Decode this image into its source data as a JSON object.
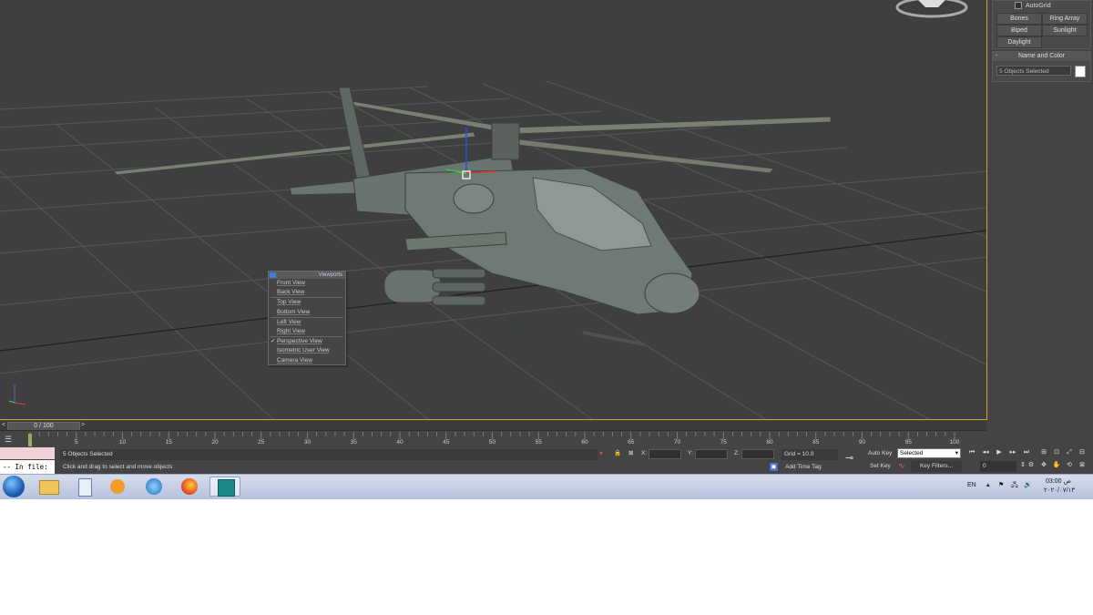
{
  "command_panel": {
    "autogrid_label": "AutoGrid",
    "buttons": [
      "Bones",
      "Ring Array",
      "Biped",
      "Sunlight",
      "Daylight"
    ],
    "name_color_title": "Name and Color",
    "name_value": "5 Objects Selected",
    "name_color_swatch": "#ffffff"
  },
  "quad_menu": {
    "title": "Viewports",
    "items": [
      "Front View",
      "Back View",
      "Top View",
      "Bottom View",
      "Left View",
      "Right View",
      "Perspective View",
      "Isometric User View",
      "Camera View"
    ],
    "checked": "Perspective View"
  },
  "timeline": {
    "frame_label": "0 / 100",
    "prev": "<",
    "next": ">",
    "ticks": [
      "5",
      "10",
      "15",
      "20",
      "25",
      "30",
      "35",
      "40",
      "45",
      "50",
      "55",
      "60",
      "65",
      "70",
      "75",
      "80",
      "85",
      "90",
      "95",
      "100"
    ]
  },
  "status": {
    "maxscript_prompt": "-- In file:",
    "selection": "5 Objects Selected",
    "prompt": "Click and drag to select and move objects",
    "x_label": "X:",
    "y_label": "Y:",
    "z_label": "Z:",
    "grid": "Grid = 10.0",
    "add_time_tag": "Add Time Tag",
    "auto_key": "Auto Key",
    "selected_option": "Selected",
    "set_key": "Set Key",
    "key_filters": "Key Filters...",
    "frame_value": "0"
  },
  "taskbar": {
    "language": "EN",
    "time": "03:00 ص",
    "date": "۲۰۲۰/۰۷/۱۳"
  },
  "colors": {
    "viewport_bg": "#3f3f3f",
    "viewport_border": "#c9a530",
    "menu_accent": "#3f7fd6"
  }
}
